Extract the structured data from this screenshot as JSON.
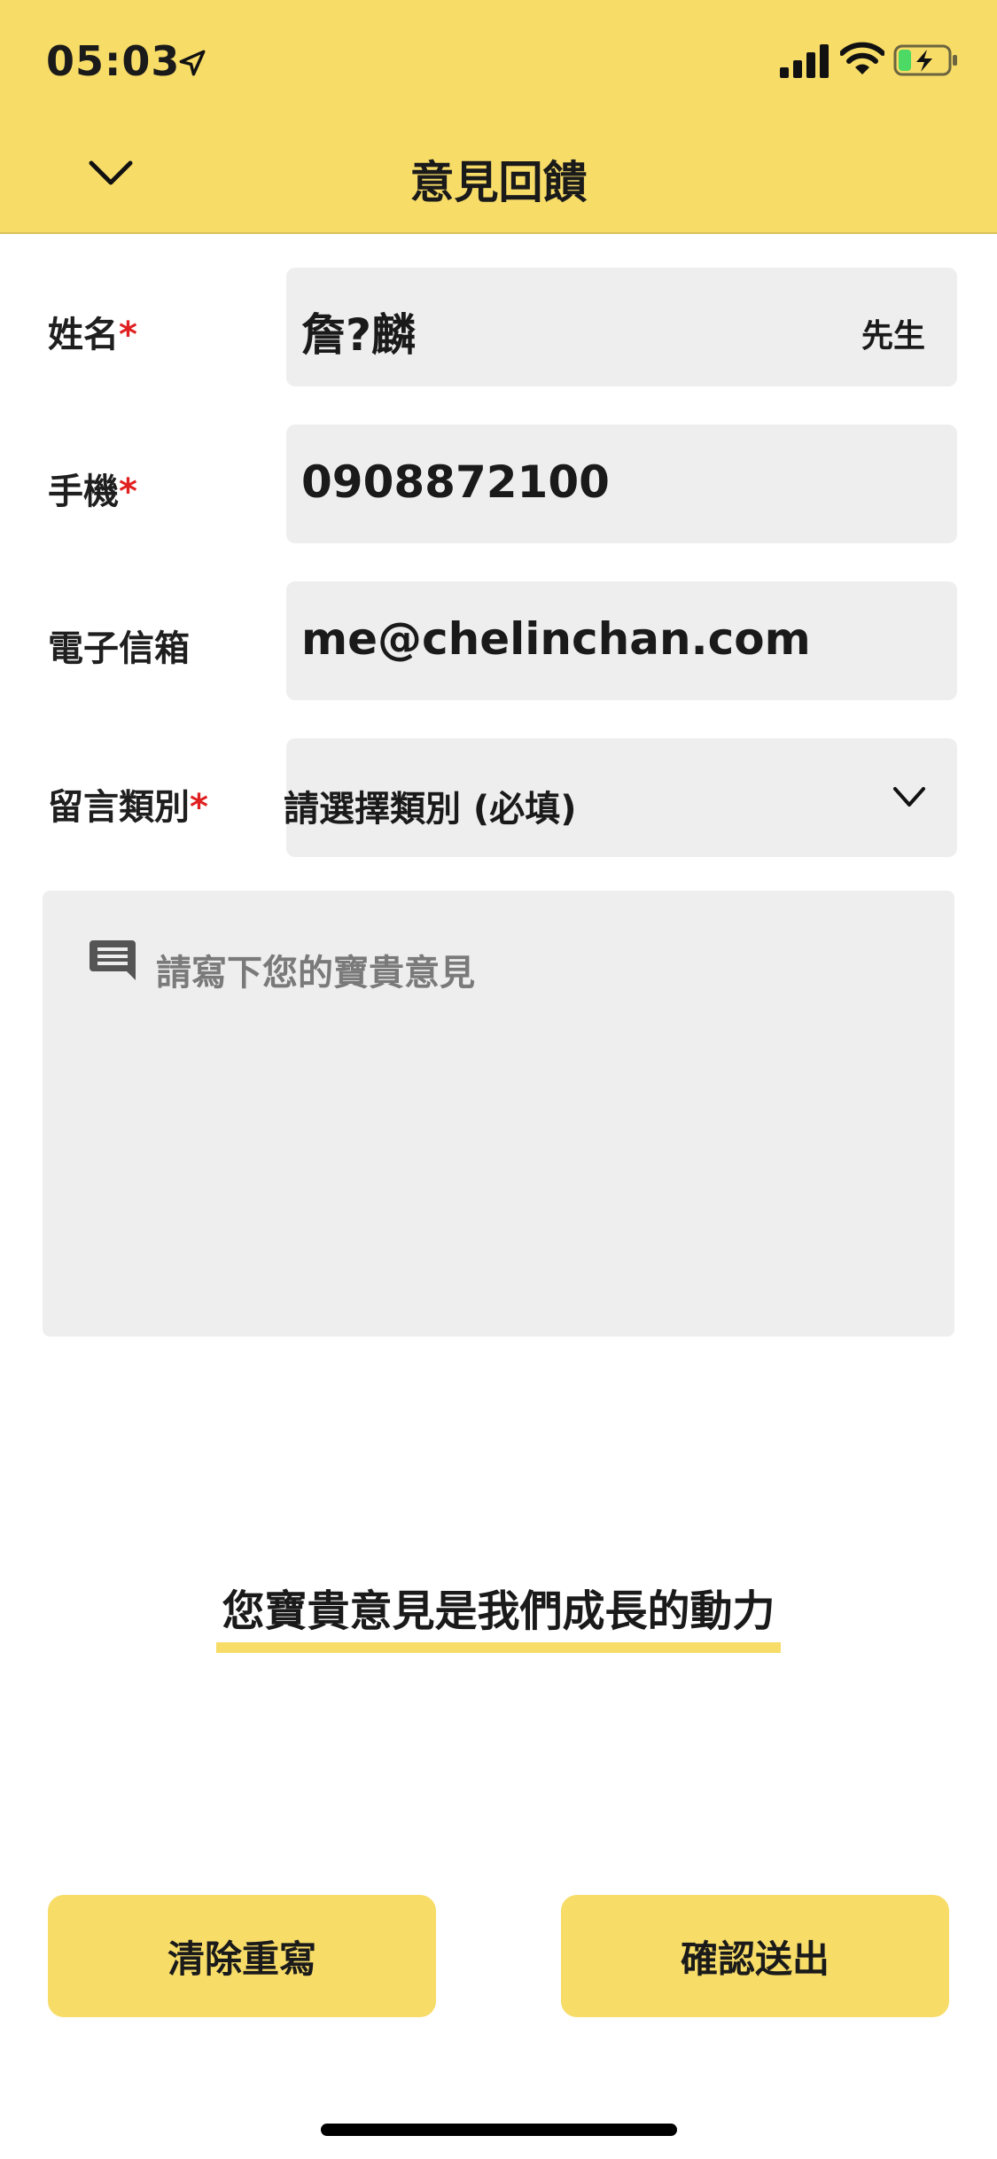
{
  "status_bar": {
    "time": "05:03",
    "icons": [
      "location-arrow-icon",
      "cellular-signal-icon",
      "wifi-icon",
      "battery-charging-icon"
    ]
  },
  "header": {
    "title": "意見回饋",
    "back_icon": "chevron-down-icon",
    "background_color": "#f7dc68"
  },
  "form": {
    "name": {
      "label": "姓名",
      "required_mark": "*",
      "value": "詹?麟",
      "title_suffix": "先生"
    },
    "phone": {
      "label": "手機",
      "required_mark": "*",
      "value": "0908872100"
    },
    "email": {
      "label": "電子信箱",
      "value": "me@chelinchan.com"
    },
    "category": {
      "label": "留言類別",
      "required_mark": "*",
      "selected": "請選擇類別 (必填)",
      "icon": "chevron-down-icon"
    },
    "message": {
      "placeholder": "請寫下您的寶貴意見",
      "icon": "message-bubble-icon"
    }
  },
  "motto": "您寶貴意見是我們成長的動力",
  "actions": {
    "clear_label": "清除重寫",
    "submit_label": "確認送出"
  },
  "colors": {
    "accent": "#f7dc68",
    "required": "#e02020",
    "field_bg": "#eeeeee"
  }
}
